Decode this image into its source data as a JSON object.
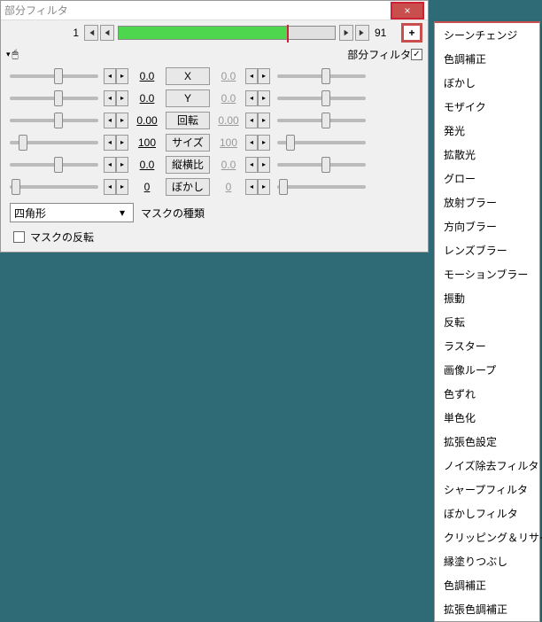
{
  "window": {
    "title": "部分フィルタ",
    "close": "×"
  },
  "timeline": {
    "start": "1",
    "end": "91",
    "plus": "+"
  },
  "section": {
    "mouse_icon": "🖱",
    "label": "部分フィルタ",
    "checked": "✓"
  },
  "params": [
    {
      "name": "X",
      "valL": "0.0",
      "valR": "0.0",
      "thumbL": 50,
      "thumbR": 50,
      "dim": true
    },
    {
      "name": "Y",
      "valL": "0.0",
      "valR": "0.0",
      "thumbL": 50,
      "thumbR": 50,
      "dim": true
    },
    {
      "name": "回転",
      "valL": "0.00",
      "valR": "0.00",
      "thumbL": 50,
      "thumbR": 50,
      "dim": true
    },
    {
      "name": "サイズ",
      "valL": "100",
      "valR": "100",
      "thumbL": 10,
      "thumbR": 10,
      "dim": true
    },
    {
      "name": "縦横比",
      "valL": "0.0",
      "valR": "0.0",
      "thumbL": 50,
      "thumbR": 50,
      "dim": true
    },
    {
      "name": "ぼかし",
      "valL": "0",
      "valR": "0",
      "thumbL": 2,
      "thumbR": 2,
      "dim": true
    }
  ],
  "mask": {
    "combo": "四角形",
    "label": "マスクの種類",
    "invert_label": "マスクの反転"
  },
  "menu": {
    "items": [
      "シーンチェンジ",
      "色調補正",
      "ぼかし",
      "モザイク",
      "発光",
      "拡散光",
      "グロー",
      "放射ブラー",
      "方向ブラー",
      "レンズブラー",
      "モーションブラー",
      "振動",
      "反転",
      "ラスター",
      "画像ループ",
      "色ずれ",
      "単色化",
      "拡張色設定",
      "ノイズ除去フィルタ",
      "シャープフィルタ",
      "ぼかしフィルタ",
      "クリッピング＆リサイズ",
      "縁塗りつぶし",
      "色調補正",
      "拡張色調補正"
    ]
  }
}
